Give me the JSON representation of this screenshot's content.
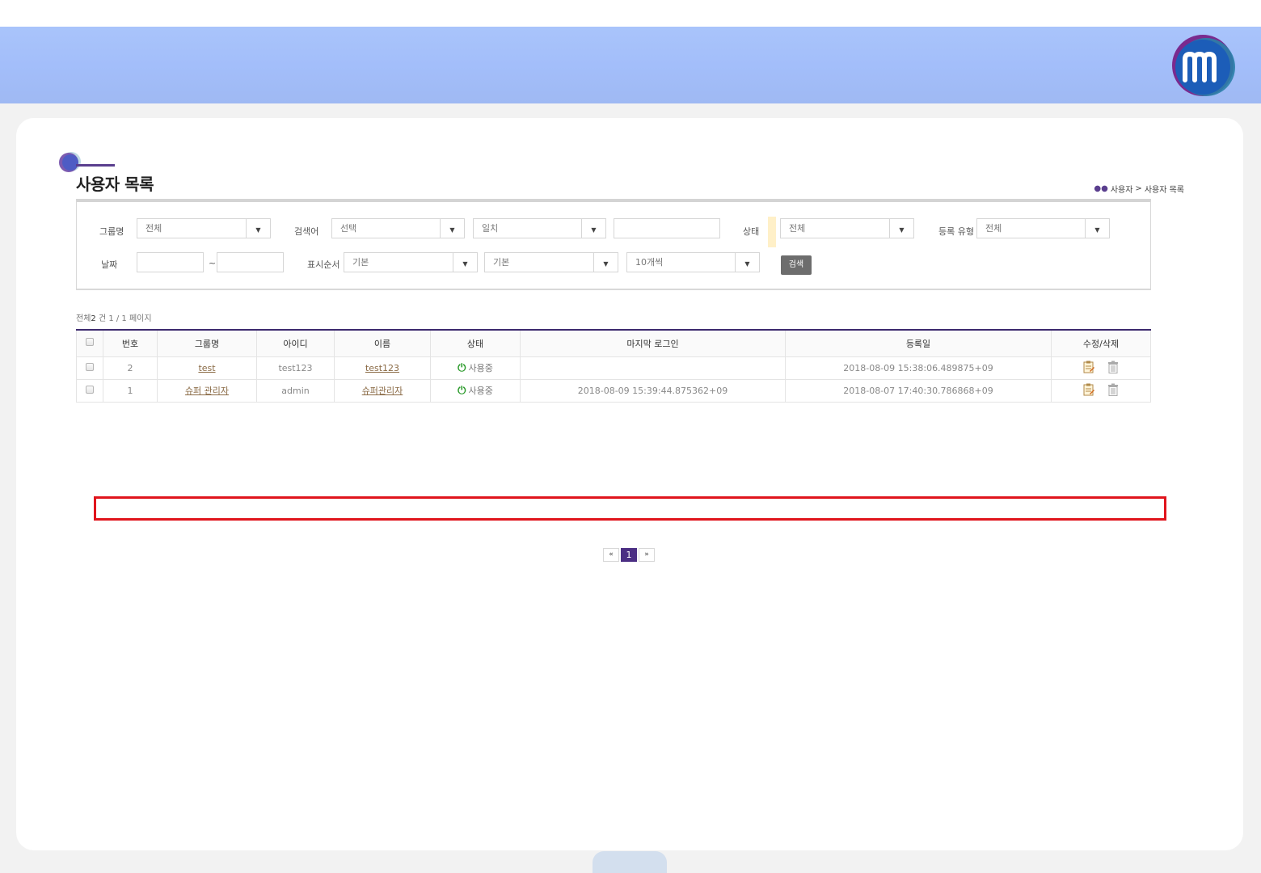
{
  "page": {
    "title": "사용자 목록",
    "breadcrumb": {
      "root": "사용자",
      "separator": ">",
      "current": "사용자 목록"
    }
  },
  "search": {
    "group_label": "그룹명",
    "group_value": "전체",
    "keyword_label": "검색어",
    "keyword_select": "선택",
    "match_select": "일치",
    "status_label": "상태",
    "status_value": "전체",
    "regtype_label": "등록 유형",
    "regtype_value": "전체",
    "date_label": "날짜",
    "date_sep": "~",
    "order_label": "표시순서",
    "order_field": "기본",
    "order_dir": "기본",
    "page_size": "10개씩",
    "search_button": "검색"
  },
  "summary": {
    "prefix": "전체",
    "count": "2",
    "suffix": "건 1 / 1 페이지"
  },
  "table": {
    "headers": [
      "번호",
      "그룹명",
      "아이디",
      "이름",
      "상태",
      "마지막 로그인",
      "등록일",
      "수정/삭제"
    ],
    "rows": [
      {
        "no": "2",
        "group": "test",
        "id": "test123",
        "name": "test123",
        "status": "사용중",
        "last_login": "",
        "registered": "2018-08-09 15:38:06.489875+09"
      },
      {
        "no": "1",
        "group": "슈퍼 관리자",
        "id": "admin",
        "name": "슈퍼관리자",
        "status": "사용중",
        "last_login": "2018-08-09 15:39:44.875362+09",
        "registered": "2018-08-07 17:40:30.786868+09"
      }
    ]
  },
  "pager": {
    "first": "«",
    "current": "1",
    "last": "»"
  },
  "colors": {
    "accent": "#4b2e83",
    "highlight": "#e0141c",
    "status_on": "#2a9a2a"
  },
  "icons": [
    "logo-m-icon",
    "people-icon",
    "power-icon",
    "edit-icon",
    "trash-icon"
  ]
}
